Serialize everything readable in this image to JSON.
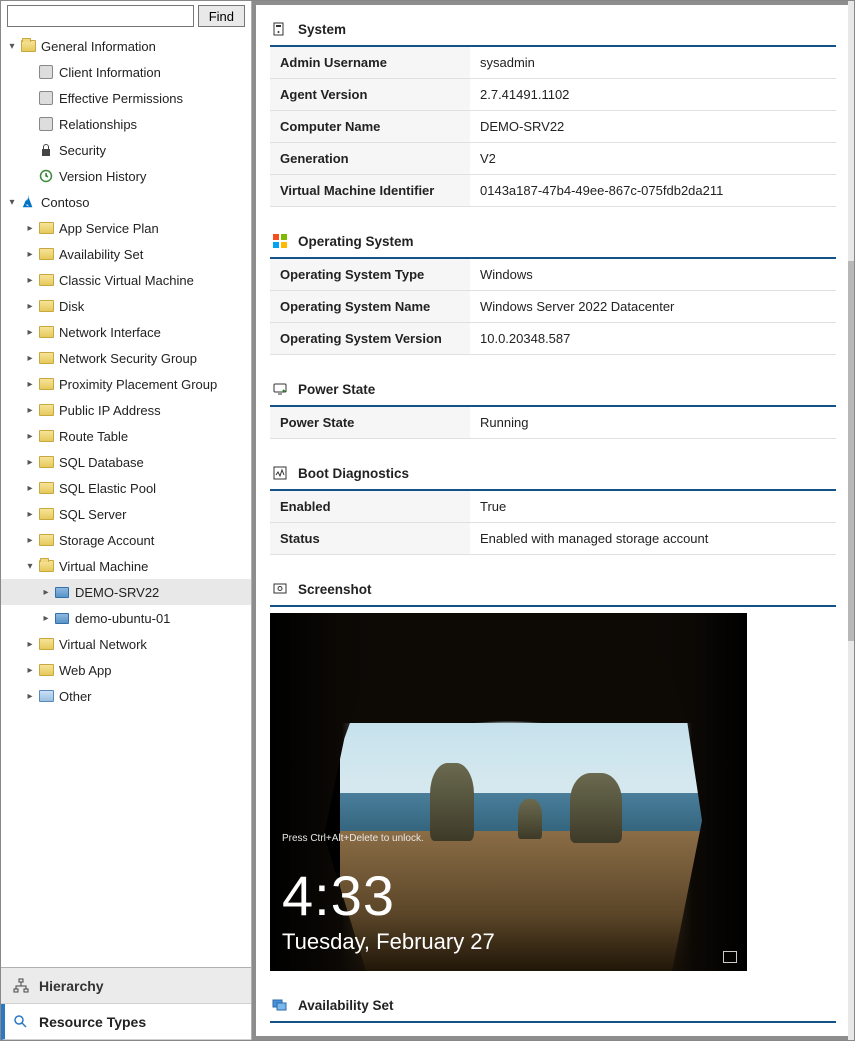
{
  "search": {
    "placeholder": "",
    "find_label": "Find"
  },
  "tree": {
    "general": {
      "label": "General Information",
      "children": {
        "client_info": "Client Information",
        "eff_perm": "Effective Permissions",
        "relationships": "Relationships",
        "security": "Security",
        "version_history": "Version History"
      }
    },
    "contoso": {
      "label": "Contoso",
      "resources": {
        "app_service_plan": "App Service Plan",
        "availability_set": "Availability Set",
        "classic_vm": "Classic Virtual Machine",
        "disk": "Disk",
        "network_interface": "Network Interface",
        "nsg": "Network Security Group",
        "ppg": "Proximity Placement Group",
        "pip": "Public IP Address",
        "route_table": "Route Table",
        "sql_db": "SQL Database",
        "sql_elastic": "SQL Elastic Pool",
        "sql_server": "SQL Server",
        "storage": "Storage Account",
        "vm": "Virtual Machine",
        "vnet": "Virtual Network",
        "webapp": "Web App",
        "other": "Other"
      },
      "vms": {
        "srv22": "DEMO-SRV22",
        "ubuntu": "demo-ubuntu-01"
      }
    }
  },
  "bottom_tabs": {
    "hierarchy": "Hierarchy",
    "resource_types": "Resource Types"
  },
  "sections": {
    "system": {
      "title": "System",
      "rows": {
        "admin_user_k": "Admin Username",
        "admin_user_v": "sysadmin",
        "agent_ver_k": "Agent Version",
        "agent_ver_v": "2.7.41491.1102",
        "comp_name_k": "Computer Name",
        "comp_name_v": "DEMO-SRV22",
        "generation_k": "Generation",
        "generation_v": "V2",
        "vmid_k": "Virtual Machine Identifier",
        "vmid_v": "0143a187-47b4-49ee-867c-075fdb2da211"
      }
    },
    "os": {
      "title": "Operating System",
      "rows": {
        "type_k": "Operating System Type",
        "type_v": "Windows",
        "name_k": "Operating System Name",
        "name_v": "Windows Server 2022 Datacenter",
        "ver_k": "Operating System Version",
        "ver_v": "10.0.20348.587"
      }
    },
    "power": {
      "title": "Power State",
      "rows": {
        "state_k": "Power State",
        "state_v": "Running"
      }
    },
    "boot": {
      "title": "Boot Diagnostics",
      "rows": {
        "enabled_k": "Enabled",
        "enabled_v": "True",
        "status_k": "Status",
        "status_v": "Enabled with managed storage account"
      }
    },
    "screenshot": {
      "title": "Screenshot",
      "lock_hint": "Press Ctrl+Alt+Delete to unlock.",
      "time": "4:33",
      "date": "Tuesday, February 27"
    },
    "avset": {
      "title": "Availability Set"
    }
  }
}
